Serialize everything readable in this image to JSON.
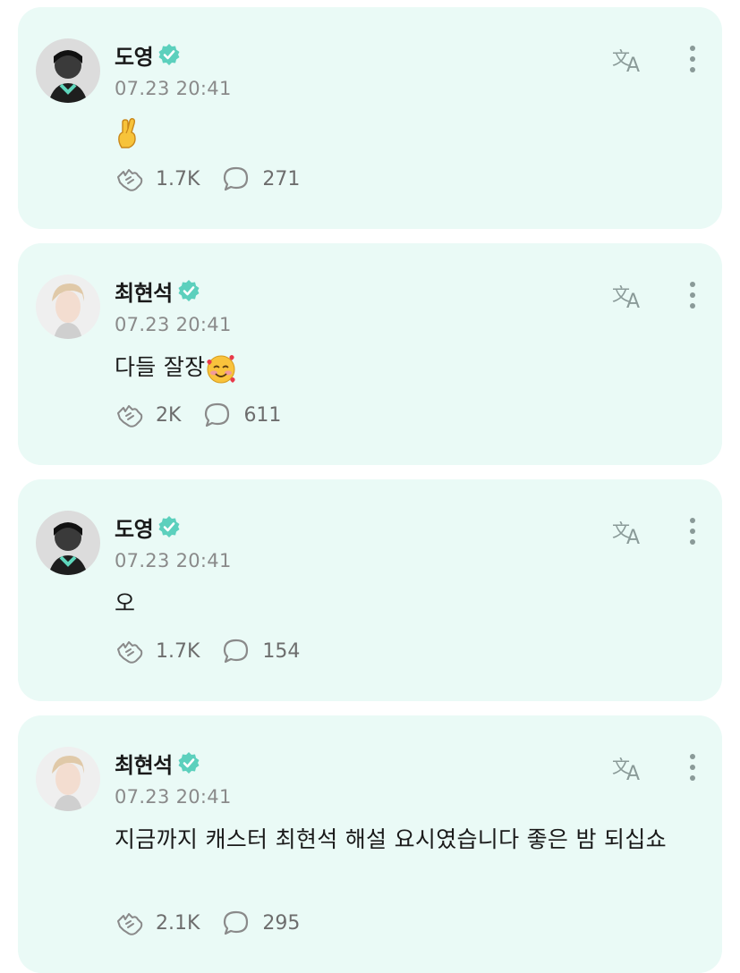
{
  "posts": [
    {
      "author": "도영",
      "time": "07.23 20:41",
      "text": "",
      "emoji": "crossed-fingers",
      "likes": "1.7K",
      "comments": "271"
    },
    {
      "author": "최현석",
      "time": "07.23 20:41",
      "text": "다들 잘장",
      "emoji": "smiling-face-with-hearts",
      "likes": "2K",
      "comments": "611"
    },
    {
      "author": "도영",
      "time": "07.23 20:41",
      "text": "오",
      "likes": "1.7K",
      "comments": "154"
    },
    {
      "author": "최현석",
      "time": "07.23 20:41",
      "text": "지금까지 캐스터 최현석 해설 요시였습니다 좋은 밤 되십쇼",
      "likes": "2.1K",
      "comments": "295"
    }
  ],
  "colors": {
    "card_bg": "#eafaf6",
    "verified": "#5cd0bd",
    "icon_gray": "#8a8a8a"
  },
  "icons": {
    "translate": "translate-icon",
    "more": "more-vertical-icon",
    "like": "like-hands-icon",
    "comment": "comment-bubble-icon",
    "verified": "verified-badge-icon"
  }
}
